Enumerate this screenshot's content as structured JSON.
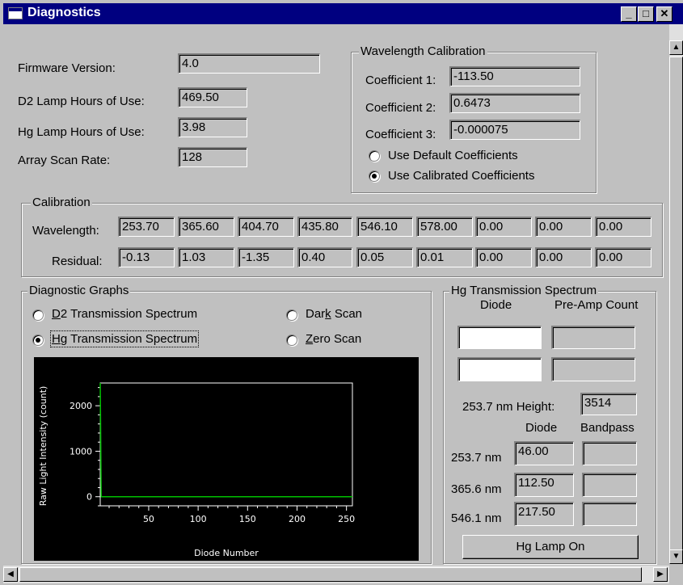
{
  "window": {
    "title": "Diagnostics"
  },
  "info": {
    "firmware_label": "Firmware Version:",
    "firmware_value": "4.0",
    "d2_label": "D2 Lamp Hours of Use:",
    "d2_value": "469.50",
    "hg_label": "Hg Lamp Hours of Use:",
    "hg_value": "3.98",
    "scan_label": "Array Scan Rate:",
    "scan_value": "128"
  },
  "wavelength_calibration": {
    "title": "Wavelength Calibration",
    "coef1_label": "Coefficient 1:",
    "coef1_value": "-113.50",
    "coef2_label": "Coefficient 2:",
    "coef2_value": "0.6473",
    "coef3_label": "Coefficient 3:",
    "coef3_value": "-0.000075",
    "use_default": "Use Default Coefficients",
    "use_calibrated": "Use Calibrated Coefficients",
    "selected": "use_calibrated"
  },
  "calibration": {
    "title": "Calibration",
    "wavelength_label": "Wavelength:",
    "residual_label": "Residual:",
    "wavelengths": [
      "253.70",
      "365.60",
      "404.70",
      "435.80",
      "546.10",
      "578.00",
      "0.00",
      "0.00",
      "0.00"
    ],
    "residuals": [
      "-0.13",
      "1.03",
      "-1.35",
      "0.40",
      "0.05",
      "0.01",
      "0.00",
      "0.00",
      "0.00"
    ]
  },
  "diagnostic_graphs": {
    "title": "Diagnostic Graphs",
    "d2_pre": "",
    "d2_ul": "D",
    "d2_post": "2 Transmission Spectrum",
    "hg_pre": "",
    "hg_ul": "H",
    "hg_post": "g Transmission Spectrum",
    "dark_pre": "Dar",
    "dark_ul": "k",
    "dark_post": " Scan",
    "zero_pre": "",
    "zero_ul": "Z",
    "zero_post": "ero Scan",
    "selected": "hg"
  },
  "chart_data": {
    "type": "line",
    "xlabel": "Diode Number",
    "ylabel": "Raw Light Intensity (count)",
    "xlim": [
      1,
      256
    ],
    "ylim": [
      -200,
      2500
    ],
    "x_ticks": [
      "50",
      "100",
      "150",
      "200",
      "250"
    ],
    "y_ticks": [
      "0",
      "1000",
      "2000"
    ],
    "x_tick_values": [
      50,
      100,
      150,
      200,
      250
    ],
    "y_tick_values": [
      0,
      1000,
      2000
    ],
    "series": [
      {
        "color": "#00c000",
        "x": [
          1,
          2,
          3,
          256
        ],
        "y": [
          2500,
          0,
          0,
          0
        ]
      }
    ]
  },
  "hg_spectrum": {
    "title": "Hg Transmission Spectrum",
    "diode_header": "Diode",
    "preamp_header": "Pre-Amp Count",
    "diode1": "",
    "preamp1": "",
    "diode2": "",
    "preamp2": "",
    "height_label": "253.7 nm Height:",
    "height_value": "3514",
    "diode_col": "Diode",
    "bandpass_col": "Bandpass",
    "rows": [
      {
        "label": "253.7 nm",
        "diode": "46.00",
        "bandpass": ""
      },
      {
        "label": "365.6 nm",
        "diode": "112.50",
        "bandpass": ""
      },
      {
        "label": "546.1 nm",
        "diode": "217.50",
        "bandpass": ""
      }
    ],
    "lamp_button": "Hg Lamp On"
  },
  "colors": {
    "titlebar": "#000080",
    "face": "#c0c0c0",
    "plot_bg": "#000000",
    "trace": "#00c000"
  }
}
